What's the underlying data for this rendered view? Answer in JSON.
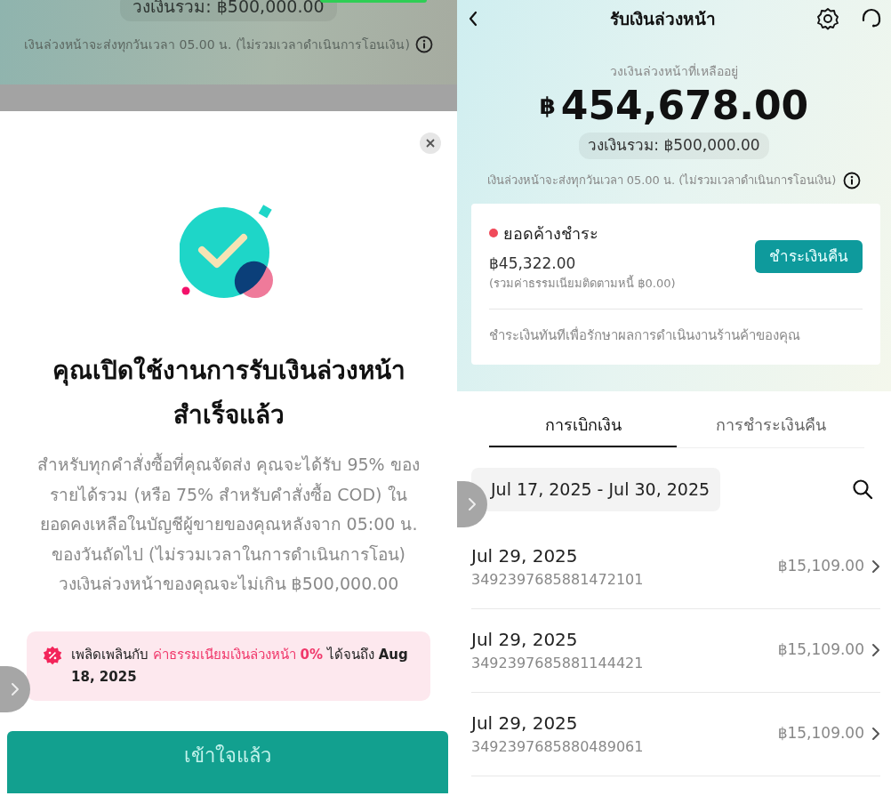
{
  "background_screen": {
    "total_limit": "วงเงินรวม: ฿500,000.00",
    "notice": "เงินล่วงหน้าจะส่งทุกวันเวลา 05.00 น. (ไม่รวมเวลาดำเนินการโอนเงิน)"
  },
  "dialog": {
    "title": "คุณเปิดใช้งานการรับเงินล่วงหน้าสำเร็จแล้ว",
    "body": "สำหรับทุกคำสั่งซื้อที่คุณจัดส่ง คุณจะได้รับ 95% ของรายได้รวม (หรือ 75% สำหรับคำสั่งซื้อ COD) ในยอดคงเหลือในบัญชีผู้ขายของคุณหลังจาก 05:00 น. ของวันถัดไป (ไม่รวมเวลาในการดำเนินการโอน) วงเงินล่วงหน้าของคุณจะไม่เกิน ฿500,000.00",
    "promo": [
      {
        "text": "เพลิดเพลินกับ ",
        "highlight": false
      },
      {
        "text": "ค่าธรรมเนียมเงินล่วงหน้า **0%**",
        "highlight": true
      },
      {
        "text": " ได้จนถึง **Aug 18, 2025**",
        "highlight": false
      }
    ],
    "button": "เข้าใจแล้ว"
  },
  "screen": {
    "title": "รับเงินล่วงหน้า",
    "balance_label": "วงเงินล่วงหน้าที่เหลืออยู่",
    "currency": "฿",
    "balance": "454,678.00",
    "total_limit": "วงเงินรวม: ฿500,000.00",
    "notice": "เงินล่วงหน้าจะส่งทุกวันเวลา 05.00 น. (ไม่รวมเวลาดำเนินการโอนเงิน)",
    "outstanding": {
      "label": "ยอดค้างชำระ",
      "color": "#f04a5a",
      "amount": "฿45,322.00",
      "note": "(รวมค่าธรรมเนียมติดตามหนี้ ฿0.00)",
      "button": "ชำระเงินคืน",
      "hint": "ชำระเงินทันทีเพื่อรักษาผลการดำเนินงานร้านค้าของคุณ"
    },
    "tabs": [
      {
        "label": "การเบิกเงิน",
        "selected": true
      },
      {
        "label": "การชำระเงินคืน",
        "selected": false
      }
    ],
    "date_range": "Jul 17, 2025 - Jul 30, 2025",
    "rows": [
      {
        "date": "Jul 29, 2025",
        "id": "3492397685881472101",
        "amount": "฿15,109.00"
      },
      {
        "date": "Jul 29, 2025",
        "id": "3492397685881144421",
        "amount": "฿15,109.00"
      },
      {
        "date": "Jul 29, 2025",
        "id": "3492397685880489061",
        "amount": "฿15,109.00"
      }
    ]
  }
}
